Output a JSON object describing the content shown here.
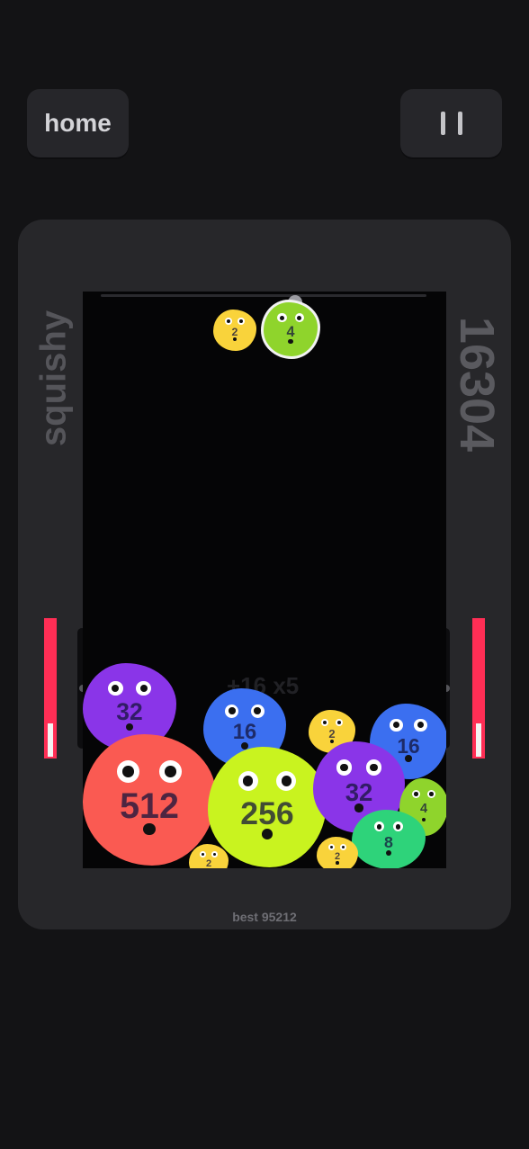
{
  "header": {
    "home_label": "home"
  },
  "game": {
    "title": "squishy",
    "score": "16304",
    "best": "best 95212",
    "combo": "+16 x5",
    "next_values": [
      "2",
      "4"
    ]
  },
  "blobs": [
    {
      "value": "2"
    },
    {
      "value": "4"
    },
    {
      "value": "32"
    },
    {
      "value": "16"
    },
    {
      "value": "2"
    },
    {
      "value": "16"
    },
    {
      "value": "512"
    },
    {
      "value": "256"
    },
    {
      "value": "32"
    },
    {
      "value": "4"
    },
    {
      "value": "8"
    },
    {
      "value": "2"
    },
    {
      "value": "2"
    }
  ],
  "colors": {
    "gauge": "#ff2e55",
    "blob_2": "#f9d33b",
    "blob_4": "#8fd42c",
    "blob_8": "#2ed37a",
    "blob_16": "#3b6ff0",
    "blob_32": "#8a35e8",
    "blob_256": "#c9f31f",
    "blob_512": "#fa5a52"
  }
}
